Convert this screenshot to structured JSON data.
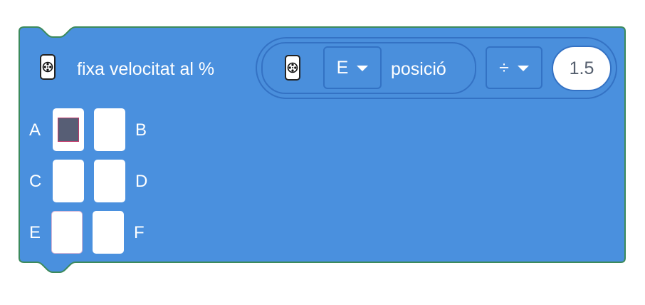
{
  "block": {
    "label": "fixa velocitat al %",
    "block_color": "#4a90de",
    "block_stroke": "#3c8a5c"
  },
  "reporter": {
    "port_value": "E",
    "label": "posició",
    "operator": "÷",
    "number": "1.5"
  },
  "ports": [
    {
      "name": "A",
      "selected": true
    },
    {
      "name": "B",
      "selected": false
    },
    {
      "name": "C",
      "selected": false
    },
    {
      "name": "D",
      "selected": false
    },
    {
      "name": "E",
      "selected": false
    },
    {
      "name": "F",
      "selected": false
    }
  ],
  "icons": {
    "motor": "motor-icon"
  }
}
